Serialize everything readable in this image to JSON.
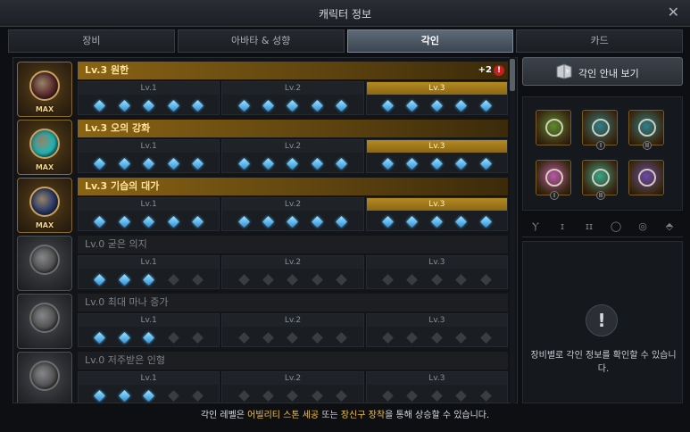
{
  "window": {
    "title": "캐릭터 정보",
    "close_icon": "close-icon"
  },
  "tabs": [
    {
      "label": "장비",
      "active": false
    },
    {
      "label": "아바타 & 성향",
      "active": false
    },
    {
      "label": "각인",
      "active": true
    },
    {
      "label": "카드",
      "active": false
    }
  ],
  "engravings": [
    {
      "name": "Lv.3 원한",
      "level": 3,
      "max_label": "MAX",
      "bonus": "+2",
      "warn": "!",
      "filled": [
        5,
        5,
        5
      ],
      "gem_color": "#5a2a2a"
    },
    {
      "name": "Lv.3 오의 강화",
      "level": 3,
      "max_label": "MAX",
      "bonus": "",
      "warn": "",
      "filled": [
        5,
        5,
        5
      ],
      "gem_color": "#1fb6b6"
    },
    {
      "name": "Lv.3 기습의 대가",
      "level": 3,
      "max_label": "MAX",
      "bonus": "",
      "warn": "",
      "filled": [
        5,
        5,
        5
      ],
      "gem_color": "#2a3a6a"
    },
    {
      "name": "Lv.0 굳은 의지",
      "level": 0,
      "max_label": "",
      "bonus": "",
      "warn": "",
      "filled": [
        3,
        0,
        0
      ],
      "gem_color": "#555"
    },
    {
      "name": "Lv.0 최대 마나 증가",
      "level": 0,
      "max_label": "",
      "bonus": "",
      "warn": "",
      "filled": [
        3,
        0,
        0
      ],
      "gem_color": "#555"
    },
    {
      "name": "Lv.0 저주받은 인형",
      "level": 0,
      "max_label": "",
      "bonus": "",
      "warn": "",
      "filled": [
        3,
        0,
        0
      ],
      "gem_color": "#555"
    }
  ],
  "level_labels": [
    "Lv.1",
    "Lv.2",
    "Lv.3"
  ],
  "guide": {
    "label": "각인 안내 보기",
    "icon": "book-icon"
  },
  "equipment": [
    {
      "name": "necklace-slot",
      "icon": "necklace-icon",
      "sub": "",
      "color": "#5b8a2f"
    },
    {
      "name": "earring-slot-1",
      "icon": "earring-icon",
      "sub": "I",
      "color": "#2f7f8a"
    },
    {
      "name": "earring-slot-2",
      "icon": "earring-icon",
      "sub": "II",
      "color": "#2f7f8a"
    },
    {
      "name": "ring-slot-1",
      "icon": "ring-icon",
      "sub": "I",
      "color": "#b85aa8"
    },
    {
      "name": "ring-slot-2",
      "icon": "ring-icon",
      "sub": "II",
      "color": "#3aa58a"
    },
    {
      "name": "stone-slot",
      "icon": "stone-icon",
      "sub": "",
      "color": "#6a4aa8"
    }
  ],
  "filters": [
    {
      "icon": "necklace-filter-icon",
      "glyph": "Ⲩ"
    },
    {
      "icon": "earring-1-filter-icon",
      "glyph": "ɪ"
    },
    {
      "icon": "earring-2-filter-icon",
      "glyph": "ɪɪ"
    },
    {
      "icon": "ring-1-filter-icon",
      "glyph": "◯"
    },
    {
      "icon": "ring-2-filter-icon",
      "glyph": "◎"
    },
    {
      "icon": "stone-filter-icon",
      "glyph": "⬘"
    }
  ],
  "info": {
    "icon": "exclamation-icon",
    "glyph": "!",
    "message": "장비별로 각인 정보를 확인할 수 있습니다."
  },
  "footer": {
    "pre": "각인 레벨은 ",
    "hl1": "어빌리티 스톤 세공",
    "mid": " 또는 ",
    "hl2": "장신구 장착",
    "post": "을 통해 상승할 수 있습니다."
  }
}
